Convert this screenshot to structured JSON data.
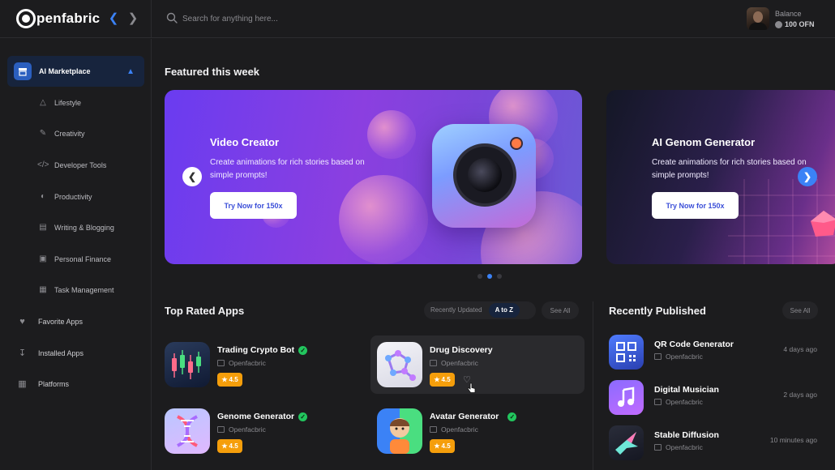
{
  "app": {
    "logo_text": "penfabric"
  },
  "header": {
    "search_placeholder": "Search for anything here...",
    "balance_label": "Balance",
    "balance_value": "100 OFN"
  },
  "sidebar": {
    "active": {
      "label": "AI Marketplace",
      "icon": "store-icon"
    },
    "sub_items": [
      {
        "label": "Lifestyle",
        "icon": "lifestyle-icon"
      },
      {
        "label": "Creativity",
        "icon": "brush-icon"
      },
      {
        "label": "Developer Tools",
        "icon": "code-icon"
      },
      {
        "label": "Productivity",
        "icon": "productivity-icon"
      },
      {
        "label": "Writing & Blogging",
        "icon": "document-icon"
      },
      {
        "label": "Personal Finance",
        "icon": "finance-icon"
      },
      {
        "label": "Task Management",
        "icon": "calendar-icon"
      }
    ],
    "main_items": [
      {
        "label": "Favorite Apps",
        "icon": "heart-icon"
      },
      {
        "label": "Installed Apps",
        "icon": "download-icon"
      },
      {
        "label": "Platforms",
        "icon": "grid-icon"
      }
    ]
  },
  "featured": {
    "title": "Featured this week",
    "slides": [
      {
        "title": "Video Creator",
        "description": "Create animations for rich stories based on simple prompts!",
        "button": "Try Now for 150x"
      },
      {
        "title": "AI Genom Generator",
        "description": "Create animations for rich stories based on simple prompts!",
        "button": "Try Now for 150x"
      }
    ],
    "active_slide": 2,
    "slide_count": 3
  },
  "top_rated": {
    "title": "Top Rated Apps",
    "filters": [
      "Recently Updated",
      "A to Z"
    ],
    "active_filter": "A to Z",
    "see_all": "See All",
    "apps": [
      {
        "name": "Trading Crypto Bot",
        "org": "Openfacbric",
        "rating": "4.5",
        "verified": true
      },
      {
        "name": "Drug Discovery",
        "org": "Openfacbric",
        "rating": "4.5",
        "verified": false
      },
      {
        "name": "Genome Generator",
        "org": "Openfacbric",
        "rating": "4.5",
        "verified": true
      },
      {
        "name": "Avatar Generator",
        "org": "Openfacbric",
        "rating": "4.5",
        "verified": true
      }
    ]
  },
  "recently_published": {
    "title": "Recently Published",
    "see_all": "See All",
    "apps": [
      {
        "name": "QR Code Generator",
        "org": "Openfacbric",
        "time": "4 days ago"
      },
      {
        "name": "Digital Musician",
        "org": "Openfacbric",
        "time": "2 days ago"
      },
      {
        "name": "Stable Diffusion",
        "org": "Openfacbric",
        "time": "10 minutes ago"
      }
    ]
  },
  "colors": {
    "accent": "#3b82f6",
    "rating": "#f59e0b",
    "verified": "#22c55e",
    "background": "#1c1c1e"
  }
}
